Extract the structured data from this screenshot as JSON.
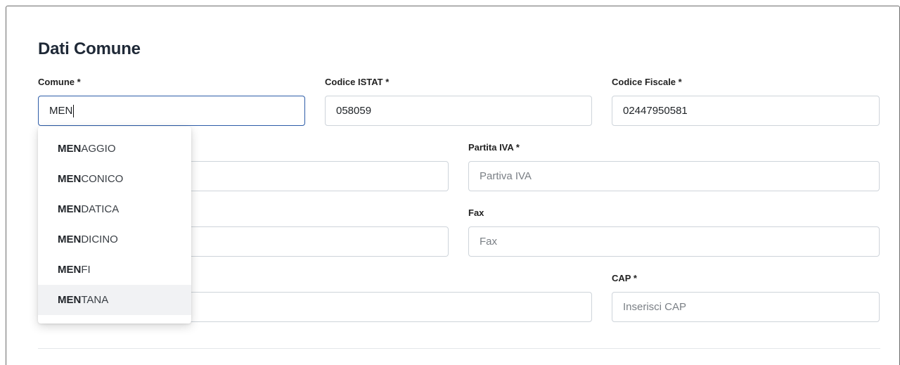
{
  "section": {
    "title": "Dati Comune"
  },
  "fields": {
    "comune": {
      "label": "Comune *",
      "value": "MEN"
    },
    "istat": {
      "label": "Codice ISTAT *",
      "value": "058059"
    },
    "codice_fiscale": {
      "label": "Codice Fiscale *",
      "value": "02447950581"
    },
    "partita_iva": {
      "label": "Partita IVA *",
      "placeholder": "Partiva IVA"
    },
    "fax": {
      "label": "Fax",
      "placeholder": "Fax"
    },
    "cap": {
      "label": "CAP *",
      "placeholder": "Inserisci CAP"
    }
  },
  "autocomplete": {
    "match": "MEN",
    "items": [
      {
        "match": "MEN",
        "rest": "AGGIO"
      },
      {
        "match": "MEN",
        "rest": "CONICO"
      },
      {
        "match": "MEN",
        "rest": "DATICA"
      },
      {
        "match": "MEN",
        "rest": "DICINO"
      },
      {
        "match": "MEN",
        "rest": "FI"
      },
      {
        "match": "MEN",
        "rest": "TANA",
        "active": true
      }
    ]
  },
  "colors": {
    "focus_border": "#2d5ca8",
    "active_item_bg": "#f1f2f4"
  }
}
